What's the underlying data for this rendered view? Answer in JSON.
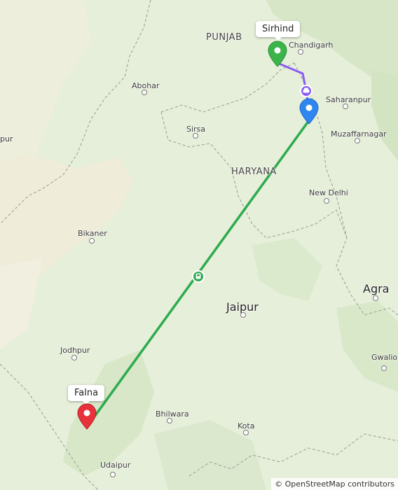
{
  "map": {
    "regions": [
      "PUNJAB",
      "HARYANA"
    ],
    "cities": {
      "chandigarh": "Chandigarh",
      "abohar": "Abohar",
      "saharanpur": "Saharanpur",
      "sirsa": "Sirsa",
      "muzaffarnagar": "Muzaffarnagar",
      "new_delhi": "New Delhi",
      "bikaner": "Bikaner",
      "agra": "Agra",
      "jaipur": "Jaipur",
      "jodhpur": "Jodhpur",
      "gwalior": "Gwalior",
      "bhilwara": "Bhilwara",
      "kota": "Kota",
      "udaipur": "Udaipur",
      "edge_left": "pur"
    },
    "markers": {
      "start": {
        "label": "Sirhind",
        "color": "#3bb54a"
      },
      "waypoint": {
        "color": "#2e86f0"
      },
      "end": {
        "label": "Falna",
        "color": "#e8323b"
      }
    },
    "routes": {
      "segment_1": {
        "color": "#8a5cf6",
        "mode_icon": "car-icon"
      },
      "segment_2": {
        "color": "#2eaa4f",
        "mode_icon": "train-icon"
      }
    },
    "attribution": "© OpenStreetMap contributors"
  }
}
